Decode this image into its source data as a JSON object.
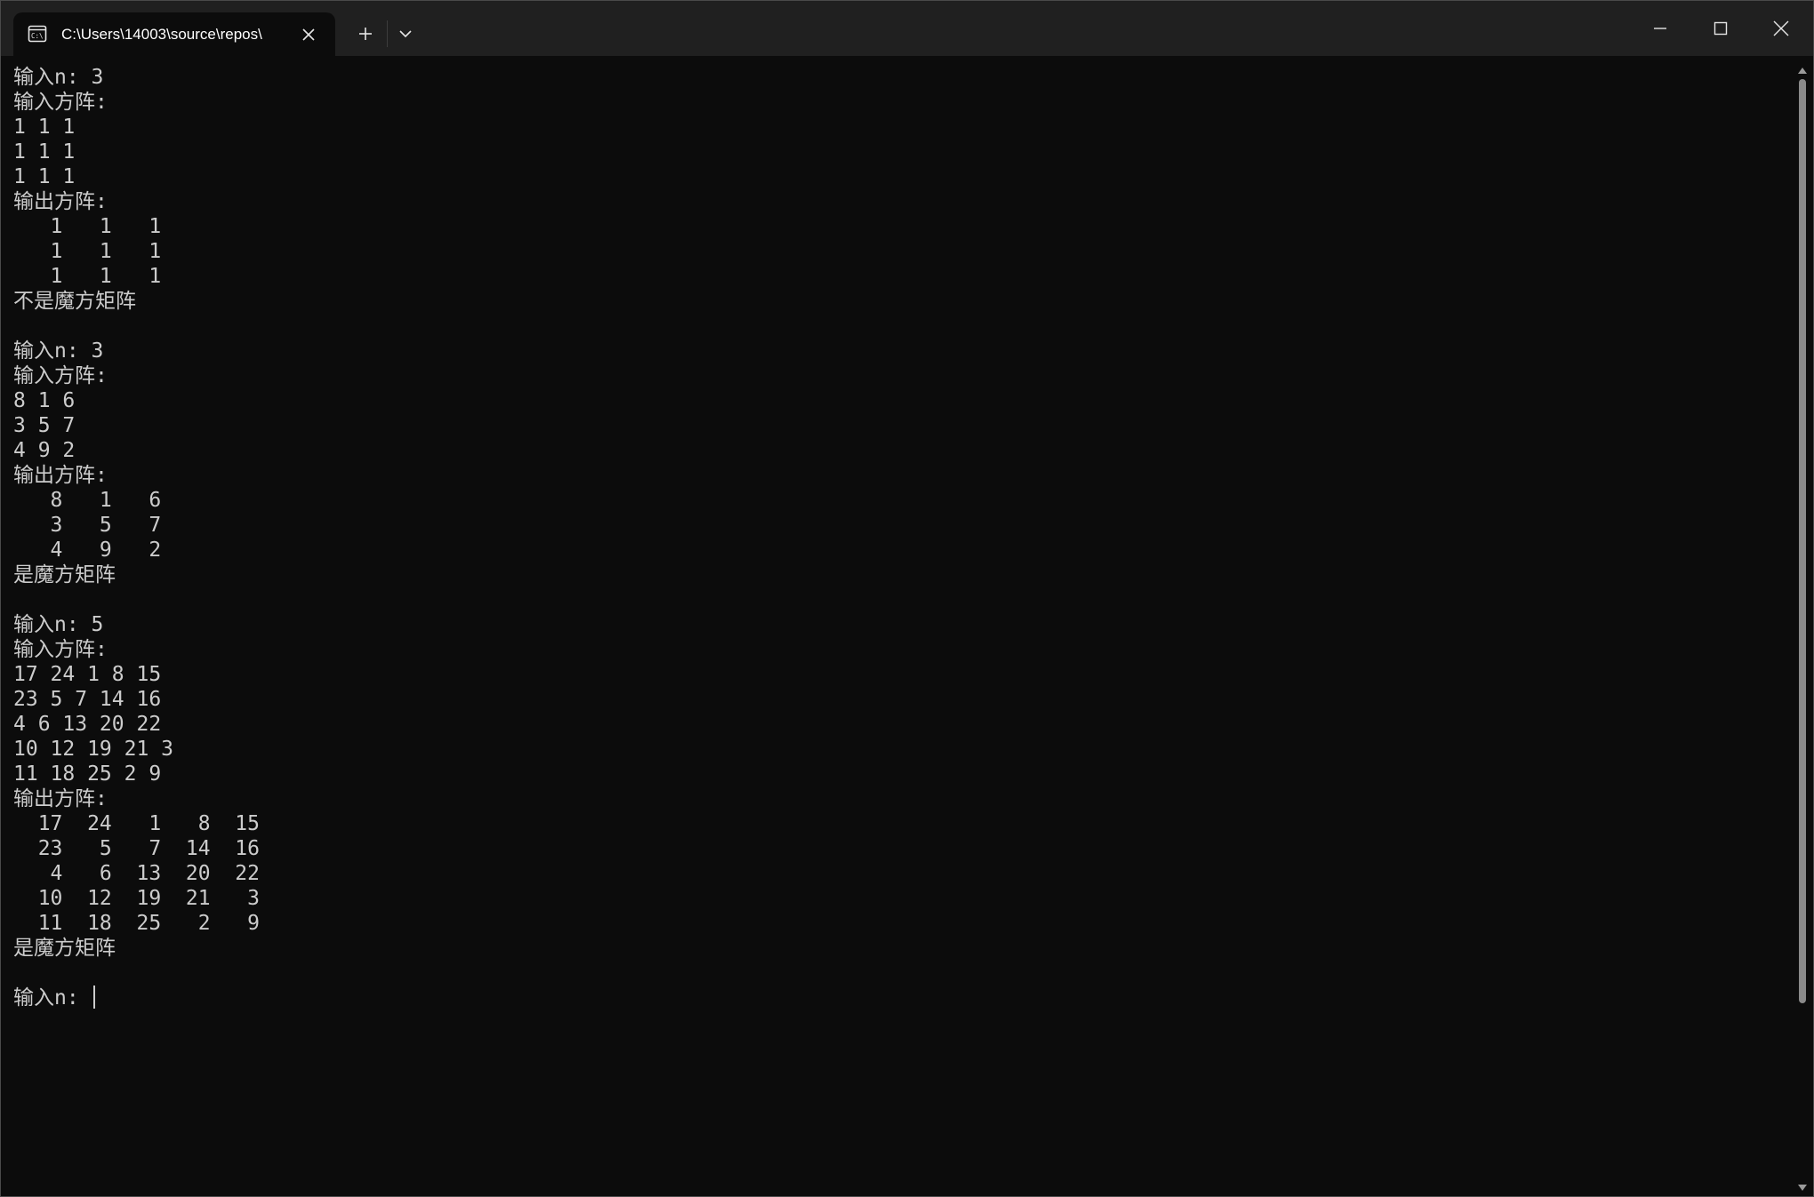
{
  "window": {
    "tab_title": "C:\\Users\\14003\\source\\repos\\"
  },
  "icons": {
    "tab_icon": "terminal-icon",
    "tab_close": "close-icon",
    "new_tab": "plus-icon",
    "dropdown": "chevron-down-icon",
    "minimize": "minimize-icon",
    "maximize": "maximize-icon",
    "close": "close-icon"
  },
  "colors": {
    "background": "#0c0c0c",
    "titlebar": "#202020",
    "text": "#cccccc"
  },
  "terminal": {
    "lines": [
      "输入n: 3",
      "输入方阵:",
      "1 1 1",
      "1 1 1",
      "1 1 1",
      "输出方阵:",
      "   1   1   1",
      "   1   1   1",
      "   1   1   1",
      "不是魔方矩阵",
      "",
      "输入n: 3",
      "输入方阵:",
      "8 1 6",
      "3 5 7",
      "4 9 2",
      "输出方阵:",
      "   8   1   6",
      "   3   5   7",
      "   4   9   2",
      "是魔方矩阵",
      "",
      "输入n: 5",
      "输入方阵:",
      "17 24 1 8 15",
      "23 5 7 14 16",
      "4 6 13 20 22",
      "10 12 19 21 3",
      "11 18 25 2 9",
      "输出方阵:",
      "  17  24   1   8  15",
      "  23   5   7  14  16",
      "   4   6  13  20  22",
      "  10  12  19  21   3",
      "  11  18  25   2   9",
      "是魔方矩阵",
      ""
    ],
    "prompt": "输入n: "
  }
}
